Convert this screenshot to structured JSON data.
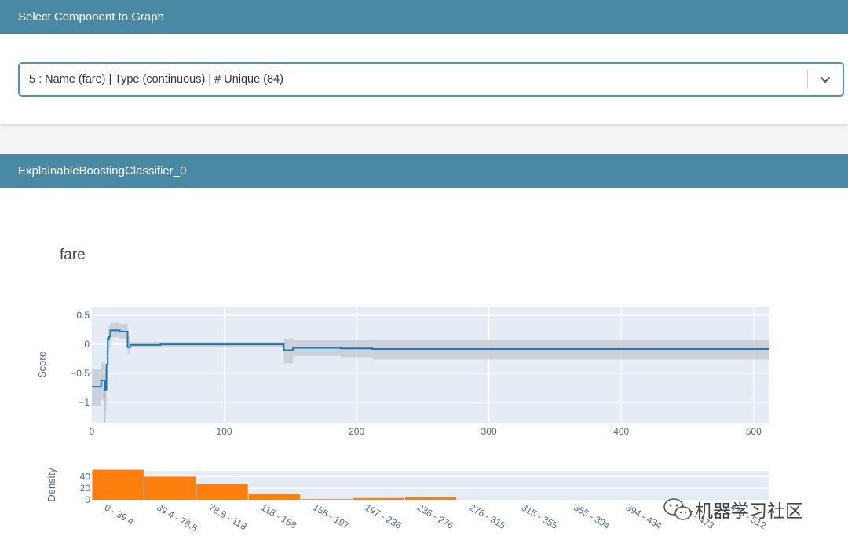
{
  "component_panel": {
    "header": "Select Component to Graph",
    "select": {
      "value": "5 : Name (fare) | Type (continuous) | # Unique (84)"
    },
    "chevron_icon": "chevron-down-icon"
  },
  "model_panel": {
    "header": "ExplainableBoostingClassifier_0",
    "chart_title": "fare"
  },
  "colors": {
    "header_bg": "#4a89a4",
    "score_line": "#1f77b4",
    "density_bar": "#ff7f0e",
    "plot_bg": "#e5ecf6",
    "ci_band": "#c8ccd4"
  },
  "chart_data": [
    {
      "type": "line",
      "ylabel": "Score",
      "xlim": [
        0,
        512
      ],
      "ylim": [
        -1.35,
        0.65
      ],
      "x_ticks": [
        0,
        100,
        200,
        300,
        400,
        500
      ],
      "y_ticks": [
        -1,
        -0.5,
        0,
        0.5
      ],
      "y_tick_labels": [
        "−1",
        "−0.5",
        "0",
        "0.5"
      ],
      "grid": true,
      "step": [
        {
          "x0": 0,
          "x1": 7,
          "y": -0.73,
          "lo": -1.05,
          "hi": -0.42
        },
        {
          "x0": 7,
          "x1": 10,
          "y": -0.62,
          "lo": -0.95,
          "hi": -0.3
        },
        {
          "x0": 10,
          "x1": 11,
          "y": -0.78,
          "lo": -1.1,
          "hi": -0.45
        },
        {
          "x0": 11,
          "x1": 12,
          "y": -0.35,
          "lo": -0.6,
          "hi": -0.1
        },
        {
          "x0": 12,
          "x1": 13,
          "y": 0.1,
          "lo": -0.1,
          "hi": 0.3
        },
        {
          "x0": 13,
          "x1": 14,
          "y": 0.13,
          "lo": -0.05,
          "hi": 0.32
        },
        {
          "x0": 14,
          "x1": 21,
          "y": 0.24,
          "lo": 0.12,
          "hi": 0.37
        },
        {
          "x0": 21,
          "x1": 27,
          "y": 0.22,
          "lo": 0.1,
          "hi": 0.35
        },
        {
          "x0": 27,
          "x1": 29,
          "y": -0.05,
          "lo": -0.15,
          "hi": 0.15
        },
        {
          "x0": 29,
          "x1": 52,
          "y": -0.01,
          "lo": -0.06,
          "hi": 0.04
        },
        {
          "x0": 52,
          "x1": 145,
          "y": 0.0,
          "lo": -0.04,
          "hi": 0.04
        },
        {
          "x0": 145,
          "x1": 152,
          "y": -0.1,
          "lo": -0.33,
          "hi": 0.1
        },
        {
          "x0": 152,
          "x1": 188,
          "y": -0.06,
          "lo": -0.2,
          "hi": 0.07
        },
        {
          "x0": 188,
          "x1": 212,
          "y": -0.07,
          "lo": -0.22,
          "hi": 0.07
        },
        {
          "x0": 212,
          "x1": 512,
          "y": -0.08,
          "lo": -0.26,
          "hi": 0.08
        }
      ],
      "end_x": 512
    },
    {
      "type": "bar",
      "ylabel": "Density",
      "ylim": [
        0,
        50
      ],
      "y_ticks": [
        0,
        20,
        40
      ],
      "categories": [
        "0 - 39.4",
        "39.4 - 78.8",
        "78.8 - 118",
        "118 - 158",
        "158 - 197",
        "197 - 236",
        "236 - 276",
        "276 - 315",
        "315 - 355",
        "355 - 394",
        "394 - 434",
        "434 - 473",
        "473 - 512"
      ],
      "values": [
        52,
        40,
        27,
        10,
        1,
        3,
        4,
        0,
        0,
        0,
        0,
        0,
        0
      ]
    }
  ],
  "watermark": "机器学习社区"
}
